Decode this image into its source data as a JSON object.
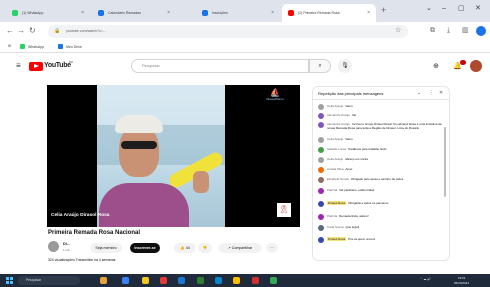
{
  "browser": {
    "tabs": [
      {
        "label": "(1) WhatsApp",
        "color": "#25d366",
        "active": false
      },
      {
        "label": "Calendário Remadas",
        "color": "#1a73e8",
        "active": false
      },
      {
        "label": "Inscrições",
        "color": "#1a73e8",
        "active": false
      },
      {
        "label": "(2) Primeira Remada Rosa",
        "color": "#ff0000",
        "active": true
      }
    ],
    "url": "youtube.com/watch?v=...",
    "bookmarks": [
      {
        "label": "WhatsApp",
        "color": "#25d366"
      },
      {
        "label": "Meu Drive",
        "color": "#1a73e8"
      }
    ]
  },
  "youtube": {
    "logo_text": "YouTube",
    "country": "BR",
    "search_placeholder": "Pesquisar"
  },
  "video": {
    "overlay_name": "Celia Araújo Dirasol Rosa",
    "logo_top_right": "DirasolRemo",
    "title": "Primeira Remada Rosa Nacional",
    "channel": "Di...",
    "subscribers": "1 mil",
    "buttons": {
      "join": "Seja membro",
      "subscribe": "Inscrever-se",
      "likes": "44",
      "share": "Compartilhar"
    },
    "meta": "324 visualizações  Transmitido há 4 semanas"
  },
  "chat": {
    "title": "Repetição das principais mensagens",
    "messages": [
      {
        "who": "Celia Araujo",
        "text": "Vamo",
        "color": "#a0a0a0",
        "mod": false
      },
      {
        "who": "Alexandre Araújo",
        "text": "Vai",
        "color": "#7e57c2",
        "mod": false
      },
      {
        "who": "Alexandre Araújo",
        "text": "Incrível o Grupo Dirasol Rosa! Um abraço! Essa é uma iniciativa da nossa Remada Rosa para toda a Região de Dirasol, Lima do Rosário",
        "color": "#7e57c2",
        "mod": false
      },
      {
        "who": "Celia Araújo",
        "text": "Vamo",
        "color": "#a0a0a0",
        "mod": false
      },
      {
        "who": "Isabelle Lucas",
        "text": "Parabéns pelo trabalho lindo",
        "color": "#43a047",
        "mod": false
      },
      {
        "who": "Celia Araújo",
        "text": "abraço em vocês",
        "color": "#a0a0a0",
        "mod": false
      },
      {
        "who": "Amélia Silva",
        "text": "Amei",
        "color": "#ef6c00",
        "mod": false
      },
      {
        "who": "Elizabeth Souza",
        "text": "Obrigado pelo apoio e carinho de todos",
        "color": "#8d6e63",
        "mod": false
      },
      {
        "who": "Patrícia",
        "text": "Vai parabéns, estão lindas",
        "color": "#9c27b0",
        "mod": false
      },
      {
        "who": "Dirasol Rosa",
        "text": "Obrigada a todos os parceiros",
        "color": "#3949ab",
        "mod": true
      },
      {
        "who": "Patrícia",
        "text": "Remada linda, adorei!",
        "color": "#9c27b0",
        "mod": false
      },
      {
        "who": "Carla Souza",
        "text": "Que legal!",
        "color": "#546e7a",
        "mod": false
      },
      {
        "who": "Dirasol Rosa",
        "text": "Pra cá quem remou!",
        "color": "#3949ab",
        "mod": true
      }
    ]
  },
  "taskbar": {
    "search": "Pesquisar",
    "time": "19:51",
    "date": "05/10/2024"
  }
}
